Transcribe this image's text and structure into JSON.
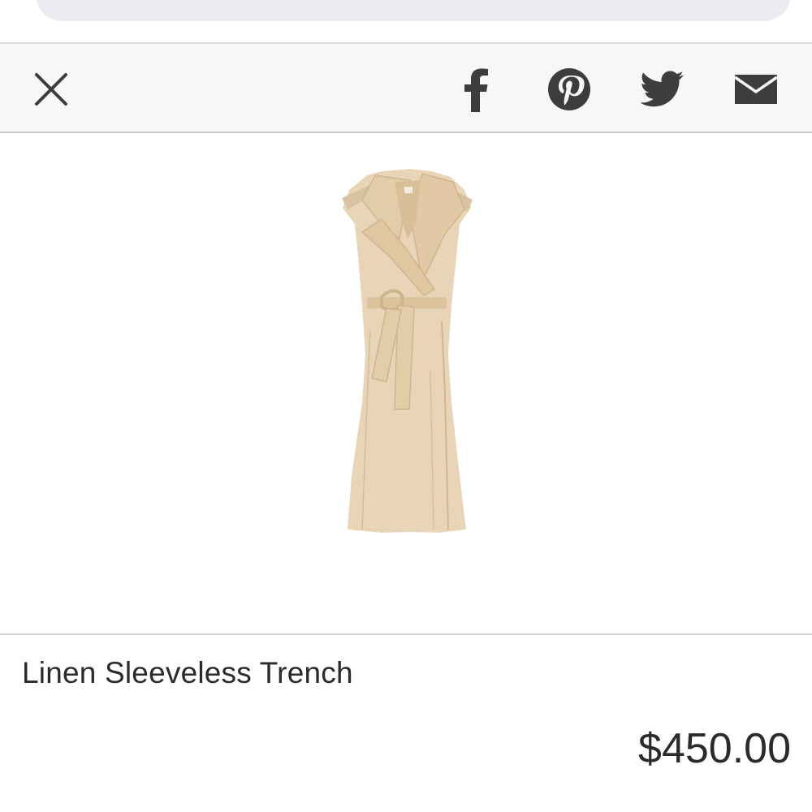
{
  "header": {
    "search_bar": "search-bar"
  },
  "toolbar": {
    "close_icon": "close-icon",
    "share_targets": [
      {
        "icon": "facebook-icon"
      },
      {
        "icon": "pinterest-icon"
      },
      {
        "icon": "twitter-icon"
      },
      {
        "icon": "email-icon"
      }
    ],
    "icon_color": "#3d3d3d"
  },
  "product": {
    "image_icon": "dress-image",
    "name": "Linen Sleeveless Trench",
    "price": "$450.00",
    "garment_color": "#e8d5b7"
  }
}
